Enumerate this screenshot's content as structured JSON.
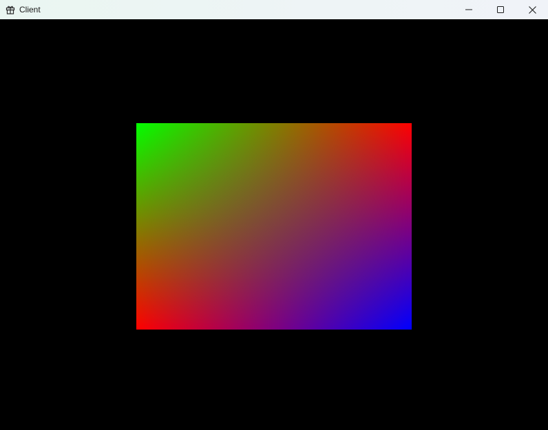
{
  "window": {
    "title": "Client",
    "icon": "gift-app-icon",
    "controls": {
      "minimize_icon": "minimize-icon",
      "maximize_icon": "maximize-icon",
      "close_icon": "close-icon"
    }
  },
  "scene": {
    "background_color": "#000000",
    "quad_corner_colors": {
      "top_left": "#00ff00",
      "top_right": "#ff0000",
      "bottom_left": "#ff0000",
      "bottom_right": "#0000ff"
    }
  }
}
